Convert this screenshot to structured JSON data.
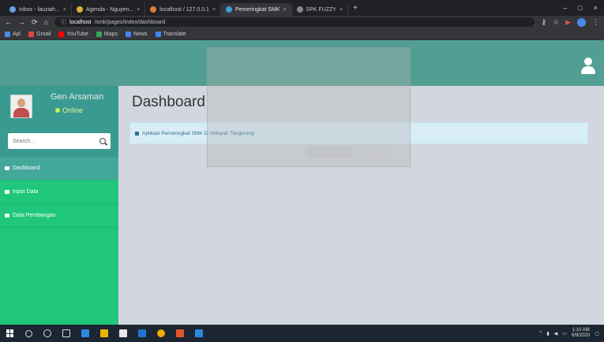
{
  "browser": {
    "tabs": [
      {
        "label": "Inbox - fauziah...",
        "active": false
      },
      {
        "label": "Agenda - Nguyen...",
        "active": false
      },
      {
        "label": "localhost / 127.0.0.1",
        "active": false
      },
      {
        "label": "Pemeringkat SMK",
        "active": true
      },
      {
        "label": "SPK FUZZY",
        "active": false
      }
    ],
    "new_tab": "+",
    "url_host": "localhost",
    "url_path": "/smk/pages/index/dashboard",
    "bookmarks": [
      {
        "label": "Apl",
        "color": "#4a8ae8"
      },
      {
        "label": "Gmail",
        "color": "#ea4335"
      },
      {
        "label": "YouTube",
        "color": "#ff0000"
      },
      {
        "label": "Maps",
        "color": "#34a853"
      },
      {
        "label": "News",
        "color": "#4285f4"
      },
      {
        "label": "Translate",
        "color": "#4285f4"
      }
    ]
  },
  "sidebar": {
    "user_name": "Gen Arsaman",
    "user_status": "Online",
    "search_placeholder": "Search...",
    "menu": [
      {
        "label": "Dashboard",
        "active": true
      },
      {
        "label": "Input Data",
        "active": false
      },
      {
        "label": "Data Pembangan",
        "active": false
      }
    ]
  },
  "main": {
    "title": "Dashboard",
    "alert": "Aplikasi Pemeringkat SMK Di Wilayah Tangerang"
  },
  "taskbar": {
    "time": "1:10 AM",
    "date": "6/9/2020"
  },
  "colors": {
    "header": "#529e93",
    "sidebar": "#20c77a",
    "content_bg": "#d2d6de",
    "alert_bg": "#d9edf7"
  }
}
